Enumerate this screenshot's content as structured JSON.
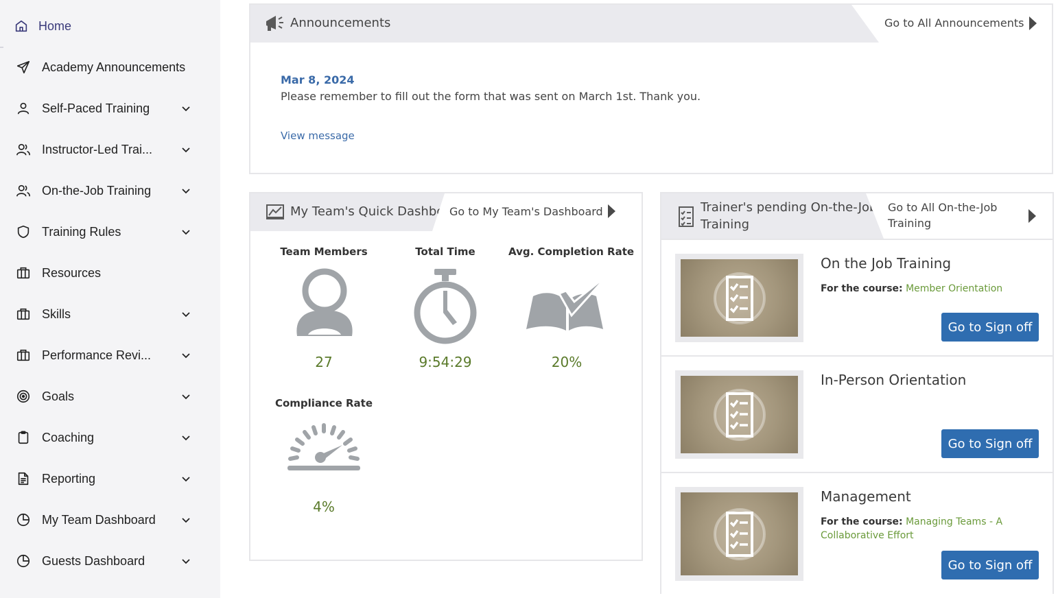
{
  "sidebar": {
    "items": [
      {
        "label": "Home",
        "icon": "home-icon",
        "active": true
      },
      {
        "label": "Academy Announcements",
        "icon": "send-icon"
      },
      {
        "label": "Self-Paced Training",
        "icon": "user-icon"
      },
      {
        "label": "Instructor-Led Trai...",
        "icon": "users-icon"
      },
      {
        "label": "On-the-Job Training",
        "icon": "users-icon"
      },
      {
        "label": "Training Rules",
        "icon": "shield-icon"
      },
      {
        "label": "Resources",
        "icon": "briefcase-icon"
      },
      {
        "label": "Skills",
        "icon": "briefcase-icon"
      },
      {
        "label": "Performance Revi...",
        "icon": "briefcase-icon"
      },
      {
        "label": "Goals",
        "icon": "target-icon"
      },
      {
        "label": "Coaching",
        "icon": "clipboard-icon"
      },
      {
        "label": "Reporting",
        "icon": "document-icon"
      },
      {
        "label": "My Team Dashboard",
        "icon": "pie-chart-icon"
      },
      {
        "label": "Guests Dashboard",
        "icon": "pie-chart-icon"
      }
    ]
  },
  "announcements": {
    "title": "Announcements",
    "goto": "Go to All Announcements",
    "date": "Mar 8, 2024",
    "message": "Please remember to fill out the form that was sent on March 1st. Thank you.",
    "link": "View message"
  },
  "team_dashboard": {
    "title": "My Team's Quick Dashboard",
    "goto": "Go to My Team's Dashboard",
    "stats": {
      "members": {
        "label": "Team Members",
        "value": "27"
      },
      "time": {
        "label": "Total Time",
        "value": "9:54:29"
      },
      "completion": {
        "label": "Avg. Completion Rate",
        "value": "20%"
      },
      "compliance": {
        "label": "Compliance Rate",
        "value": "4%"
      }
    }
  },
  "ojt": {
    "title_line1": "Trainer's pending On-the-Job",
    "title_line2": "Training",
    "goto_line1": "Go to All On-the-Job",
    "goto_line2": "Training",
    "course_prefix": "For the course:",
    "items": [
      {
        "title": "On the Job Training",
        "course": "Member Orientation",
        "button": "Go to Sign off"
      },
      {
        "title": "In-Person Orientation",
        "course": "",
        "button": "Go to Sign off"
      },
      {
        "title": "Management",
        "course": "Managing Teams - A Collaborative Effort",
        "button": "Go to Sign off"
      }
    ]
  },
  "colors": {
    "accent_blue": "#2f6db0",
    "link_blue": "#3a6aa8",
    "value_green": "#5a7a2a",
    "sidebar_bg": "#f4f4f6"
  }
}
